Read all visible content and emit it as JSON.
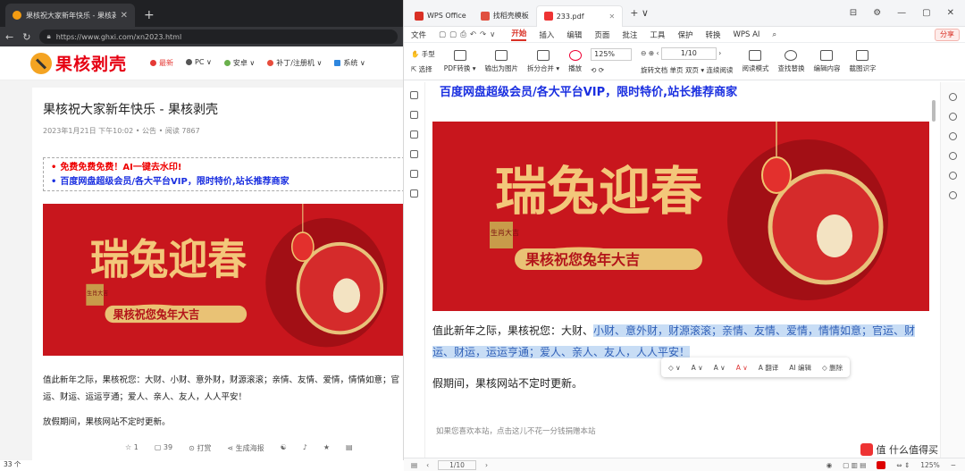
{
  "browser": {
    "tab_title": "果核祝大家新年快乐 - 果核剥壳",
    "tab_close": "✕",
    "new_tab": "+",
    "url": "https://www.ghxi.com/xn2023.html",
    "site": {
      "logo_text": "果核剥壳",
      "nav": [
        "最新",
        "PC ∨",
        "安卓 ∨",
        "补丁/注册机 ∨",
        "系统 ∨"
      ]
    },
    "article": {
      "title": "果核祝大家新年快乐 - 果核剥壳",
      "meta": "2023年1月21日 下午10:02 • 公告 • 阅读 7867",
      "promo_red": "免费免费免费！AI一键去水印!",
      "promo_blue": "百度网盘超级会员/各大平台VIP，限时特价,站长推荐商家",
      "body_text": "值此新年之际，果核祝您：大财、小财、意外财，财源滚滚；亲情、友情、爱情，情情如意；官运、财运、运运亨通；爱人、亲人、友人，人人平安！",
      "body_text2": "放假期间，果核网站不定时更新。",
      "actions": [
        "☆ 1",
        "▢ 39",
        "⊙ 打赏",
        "⋖ 生成海报"
      ]
    }
  },
  "wps": {
    "tabs": [
      {
        "label": "WPS Office",
        "color": "#d93025"
      },
      {
        "label": "找稻壳模板",
        "color": "#e05040"
      },
      {
        "label": "233.pdf",
        "color": "#e33"
      }
    ],
    "tab_close": "✕",
    "new_tab": "+ ∨",
    "window_controls": [
      "⊟",
      "⚙",
      "—",
      "▢",
      "✕"
    ],
    "menu": [
      "文件",
      "开始",
      "插入",
      "编辑",
      "页面",
      "批注",
      "工具",
      "保护",
      "转换",
      "WPS AI"
    ],
    "active_menu": "开始",
    "share_label": "分享",
    "ribbon": {
      "hand": "手型",
      "select": "选择",
      "pdf_convert": "PDF转换 ▾",
      "export_image": "输出为图片",
      "split_merge": "拆分合并 ▾",
      "play": "播放",
      "zoom": "125%",
      "page": "1/10",
      "rotate": "旋转文档",
      "single": "单页",
      "double": "双页 ▾",
      "continuous": "连续阅读",
      "read_mode": "阅读模式",
      "find_replace": "查找替换",
      "edit_content": "编辑内容",
      "screenshot": "截图识字"
    },
    "doc": {
      "header": "百度网盘超级会员/各大平台VIP，限时特价,站长推荐商家",
      "text_plain": "值此新年之际，果核祝您：大财、",
      "text_highlight": "小财、意外财，财源滚滚；亲情、友情、爱情，情情如意；官运、财运、财运，运运亨通；爱人、亲人、友人，人人平安！",
      "text2": "假期间，果核网站不定时更新。",
      "footer": "如果您喜欢本站，点击这儿不花一分钱捐赠本站",
      "float_toolbar": [
        "◇ ∨",
        "A ∨",
        "A ∨",
        "A ∨",
        "A 翻译",
        "AI 编辑",
        "◇ 删除"
      ]
    },
    "status": {
      "page": "1/10",
      "zoom": "125%"
    }
  },
  "banner": {
    "title": "瑞兔迎春",
    "subtitle": "果核祝您兔年大吉",
    "stamp": "生肖大吉"
  },
  "watermark": "值 什么值得买",
  "counter": "33 个"
}
